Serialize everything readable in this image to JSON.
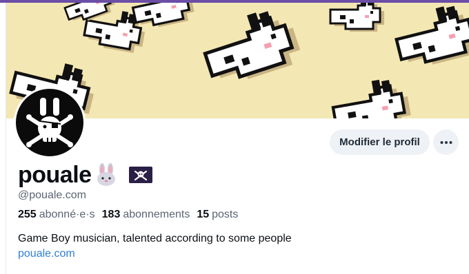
{
  "profile": {
    "display_name": "pouale",
    "handle": "@pouale.com",
    "bio": "Game Boy musician, talented according to some people",
    "link": "pouale.com",
    "stats": {
      "followers_count": "255",
      "followers_label": "abonné·e·s",
      "following_count": "183",
      "following_label": "abonnements",
      "posts_count": "15",
      "posts_label": "posts"
    }
  },
  "actions": {
    "edit_profile_label": "Modifier le profil",
    "more_icon": "ellipsis-icon"
  },
  "banner": {
    "icon": "pixel-rabbit-pattern",
    "bg_color": "#f3e7b3"
  },
  "avatar": {
    "icon": "rabbit-skull-crossbones-icon"
  },
  "colors": {
    "accent_top": "#6b4ea6",
    "link": "#2f7fd7",
    "muted": "#5b6573"
  }
}
